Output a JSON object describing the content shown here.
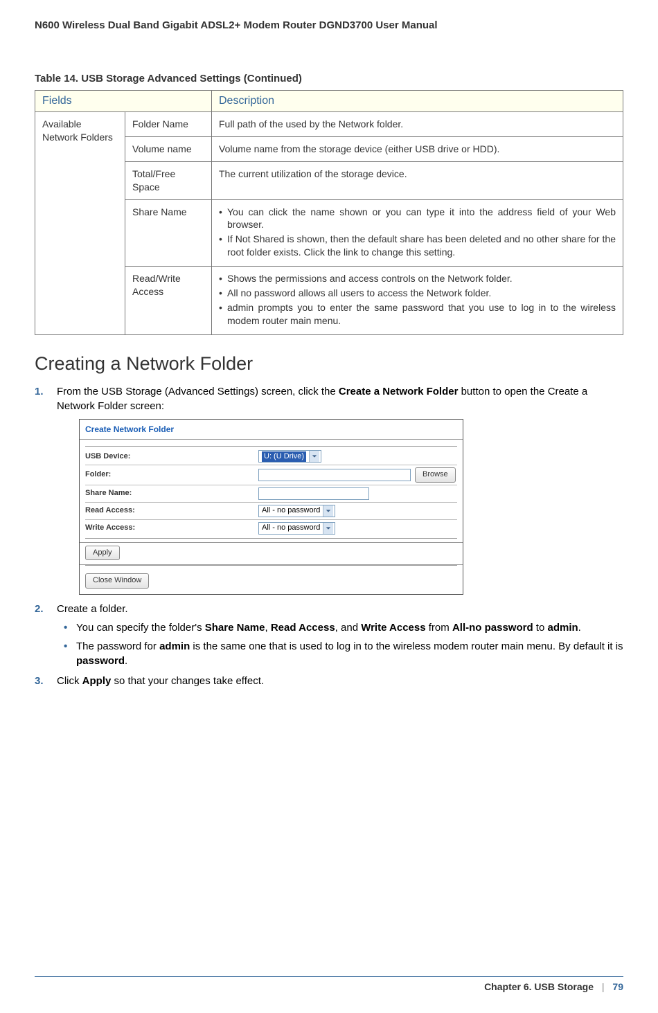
{
  "header": {
    "title": "N600 Wireless Dual Band Gigabit ADSL2+ Modem Router DGND3700 User Manual"
  },
  "table": {
    "caption": "Table 14.  USB Storage Advanced Settings  (Continued)",
    "head_fields": "Fields",
    "head_desc": "Description",
    "group_label": "Available Network Folders",
    "rows": [
      {
        "field": "Folder Name",
        "desc": "Full path of the used by the Network folder."
      },
      {
        "field": "Volume name",
        "desc": "Volume name from the storage device (either USB drive or HDD)."
      },
      {
        "field": "Total/Free Space",
        "desc": "The current utilization of the storage device."
      },
      {
        "field": "Share Name",
        "bullets": [
          "You can click the name shown or you can type it into the address field of your Web browser.",
          "If Not Shared is shown, then the default share has been deleted and no other share for the root folder exists. Click the link to change this setting."
        ]
      },
      {
        "field": "Read/Write Access",
        "bullets": [
          "Shows the permissions and access controls on the Network folder.",
          "All no password allows all users to access the Network folder.",
          "admin prompts you to enter the same password that you use to log in to the wireless modem router main menu."
        ]
      }
    ]
  },
  "section": {
    "heading": "Creating a Network Folder",
    "step1_pre": "From the USB Storage (Advanced Settings) screen, click the ",
    "step1_bold": "Create a Network Folder",
    "step1_post": " button to open the Create a Network Folder screen:",
    "step2_text": "Create a folder.",
    "step2_b1_pre": "You can specify the folder's ",
    "step2_b1_b1": "Share Name",
    "step2_b1_mid1": ", ",
    "step2_b1_b2": "Read Access",
    "step2_b1_mid2": ", and ",
    "step2_b1_b3": "Write Access",
    "step2_b1_mid3": " from ",
    "step2_b1_b4": "All-no password",
    "step2_b1_mid4": " to ",
    "step2_b1_b5": "admin",
    "step2_b1_end": ".",
    "step2_b2_pre": "The password for ",
    "step2_b2_b1": "admin",
    "step2_b2_mid": " is the same one that is used to log in to the wireless modem router main menu. By default it is ",
    "step2_b2_b2": "password",
    "step2_b2_end": ".",
    "step3_pre": "Click ",
    "step3_bold": "Apply",
    "step3_post": " so that your changes take effect."
  },
  "screenshot": {
    "title": "Create Network Folder",
    "labels": {
      "usb_device": "USB Device:",
      "folder": "Folder:",
      "share_name": "Share Name:",
      "read_access": "Read Access:",
      "write_access": "Write Access:"
    },
    "values": {
      "usb_device": "U: (U Drive)",
      "folder": "",
      "share_name": "",
      "read_access": "All - no password",
      "write_access": "All - no password"
    },
    "browse": "Browse",
    "apply": "Apply",
    "close": "Close Window"
  },
  "footer": {
    "chapter": "Chapter 6.  USB Storage",
    "page": "79"
  }
}
